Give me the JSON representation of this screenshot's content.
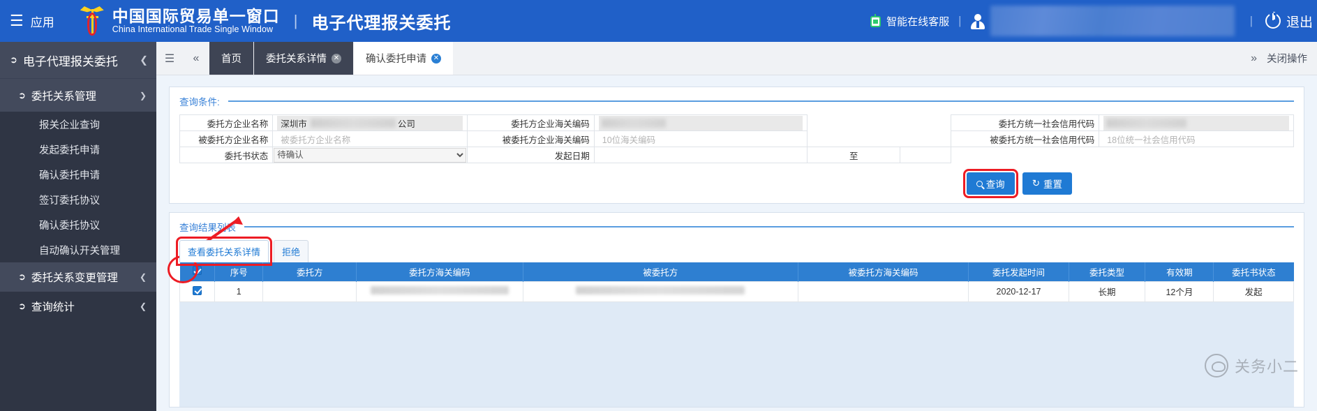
{
  "header": {
    "menu_icon": "hamburger-icon",
    "apps_label": "应用",
    "brand_cn": "中国国际贸易单一窗口",
    "brand_en": "China International Trade Single Window",
    "divider": "|",
    "subtitle": "电子代理报关委托",
    "service_label": "智能在线客服",
    "sep2": "|",
    "sep3": "|",
    "exit_label": "退出"
  },
  "sidebar": {
    "root_label": "电子代理报关委托",
    "collapse_icon": "chevron-left-icon",
    "group_label": "委托关系管理",
    "group_chevron": "chevron-down-icon",
    "items": [
      {
        "label": "报关企业查询"
      },
      {
        "label": "发起委托申请"
      },
      {
        "label": "确认委托申请"
      },
      {
        "label": "签订委托协议"
      },
      {
        "label": "确认委托协议"
      },
      {
        "label": "自动确认开关管理"
      }
    ],
    "group2_label": "委托关系变更管理",
    "group2_chevron": "chevron-left-icon",
    "group3_label": "查询统计",
    "group3_chevron": "chevron-left-icon"
  },
  "tabbar": {
    "menu_icon": "list-icon",
    "prev_icon": "double-chevron-left-icon",
    "next_icon": "double-chevron-right-icon",
    "close_all_label": "关闭操作",
    "tabs": [
      {
        "label": "首页",
        "closable": false,
        "active": false
      },
      {
        "label": "委托关系详情",
        "closable": true,
        "active": false
      },
      {
        "label": "确认委托申请",
        "closable": true,
        "active": true
      }
    ],
    "close_glyph": "✕"
  },
  "query_panel": {
    "title": "查询条件:",
    "fields": {
      "entruster_name_label": "委托方企业名称",
      "entruster_name_value_prefix": "深圳市",
      "entruster_name_value_suffix": "公司",
      "entruster_customs_code_label": "委托方企业海关编码",
      "entruster_credit_code_label": "委托方统一社会信用代码",
      "entrusted_name_label": "被委托方企业名称",
      "entrusted_name_placeholder": "被委托方企业名称",
      "entrusted_customs_code_label": "被委托方企业海关编码",
      "entrusted_customs_code_placeholder": "10位海关编码",
      "entrusted_credit_code_label": "被委托方统一社会信用代码",
      "entrusted_credit_code_placeholder": "18位统一社会信用代码",
      "status_label": "委托书状态",
      "status_value": "待确认",
      "status_options": [
        "待确认"
      ],
      "start_date_label": "发起日期",
      "start_date_value": "",
      "date_separator": "至",
      "end_date_value": ""
    },
    "buttons": {
      "search_label": "查询",
      "search_icon": "magnifier-icon",
      "reset_label": "重置",
      "reset_icon": "refresh-icon"
    }
  },
  "result_panel": {
    "title": "查询结果列表",
    "toolbar": [
      {
        "label": "查看委托关系详情",
        "active": true
      },
      {
        "label": "拒绝",
        "active": false
      }
    ],
    "columns": [
      "",
      "序号",
      "委托方",
      "委托方海关编码",
      "被委托方",
      "被委托方海关编码",
      "委托发起时间",
      "委托类型",
      "有效期",
      "委托书状态"
    ],
    "rows": [
      {
        "checked": true,
        "index": "1",
        "entruster": "",
        "entruster_code": "",
        "entrusted": "",
        "entrusted_code": "",
        "start_time": "2020-12-17",
        "type": "长期",
        "validity": "12个月",
        "status": "发起"
      }
    ]
  },
  "watermark": {
    "text": "关务小二",
    "icon": "wechat-logo-icon"
  },
  "colors": {
    "header_blue": "#2060c8",
    "sidebar_dark": "#2f3544",
    "accent_blue": "#1f7ad4",
    "annotation_red": "#ed1c24",
    "table_header_blue": "#2e7fd1"
  }
}
